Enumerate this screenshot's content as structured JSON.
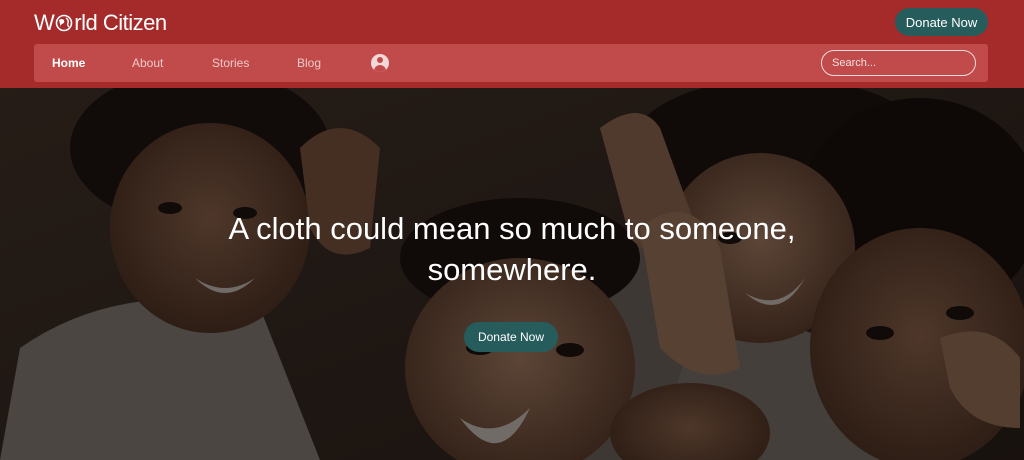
{
  "brand": {
    "name_prefix": "W",
    "name_middle": "rld Citizen"
  },
  "header": {
    "donate_label": "Donate Now"
  },
  "nav": {
    "items": [
      {
        "label": "Home",
        "active": true
      },
      {
        "label": "About"
      },
      {
        "label": "Stories"
      },
      {
        "label": "Blog"
      }
    ],
    "account_icon": "user-circle-icon"
  },
  "search": {
    "placeholder": "Search...",
    "value": ""
  },
  "hero": {
    "headline": "A cloth could mean so much to someone, somewhere.",
    "donate_label": "Donate Now",
    "image": "photo of smiling children"
  },
  "colors": {
    "header_bg": "#a52a2a",
    "navbar_bg": "#c14a4a",
    "button_bg": "#275c5c",
    "text_light": "#ffffff"
  }
}
